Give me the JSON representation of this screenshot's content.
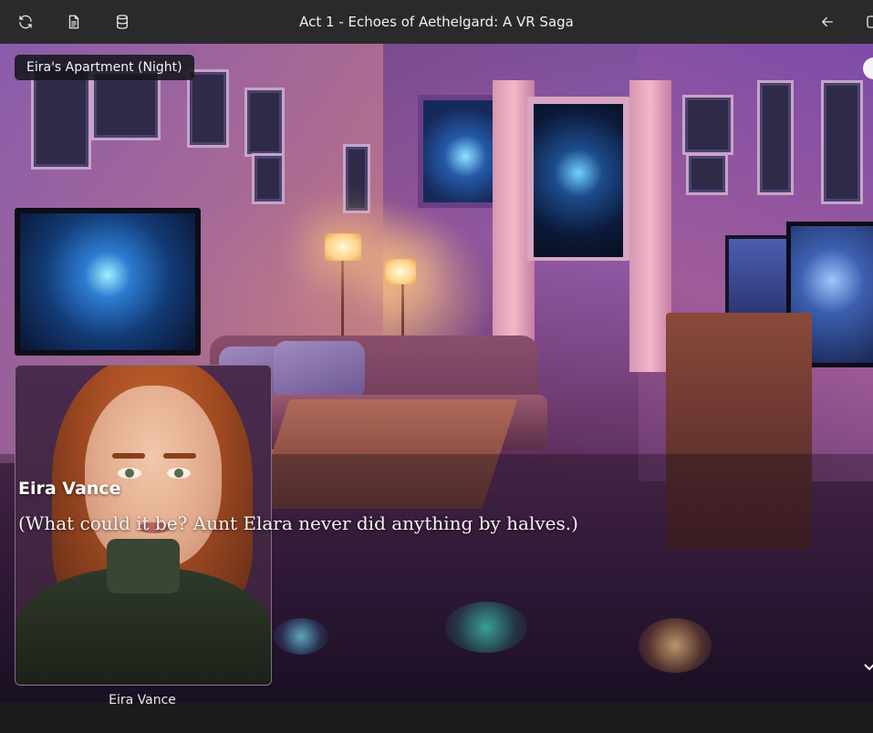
{
  "header": {
    "title": "Act 1 - Echoes of Aethelgard: A VR Saga",
    "icons": [
      "refresh-icon",
      "document-icon",
      "database-icon",
      "arrow-left-icon",
      "settings-icon"
    ]
  },
  "scene": {
    "location": "Eira's Apartment (Night)"
  },
  "dialogue": {
    "speaker": "Eira Vance",
    "text": "(What could it be? Aunt Elara never did anything by halves.)"
  },
  "portrait": {
    "caption": "Eira Vance"
  },
  "colors": {
    "topbar": "#2a2a2c",
    "badge_bg": "#16161c",
    "text": "#f4f4f4"
  }
}
